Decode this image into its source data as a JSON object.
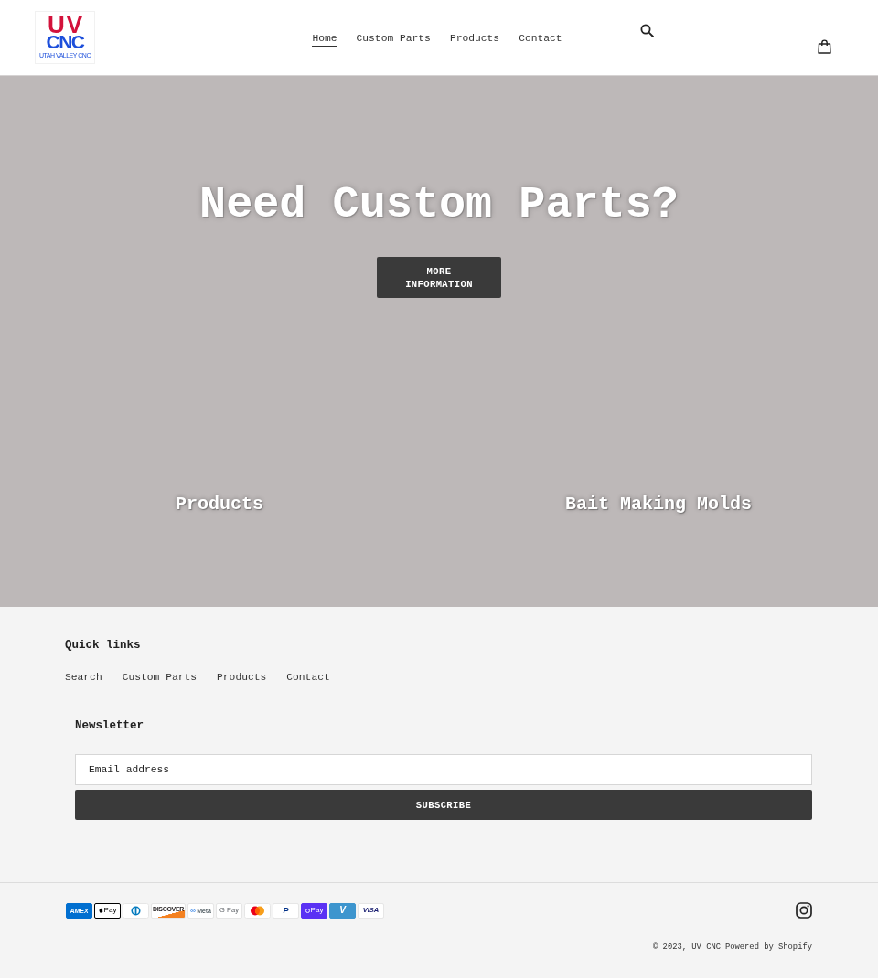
{
  "header": {
    "logo": {
      "top": "UV",
      "middle": "CNC",
      "tagline": "UTAH VALLEY CNC"
    },
    "nav": [
      {
        "label": "Home",
        "selected": true
      },
      {
        "label": "Custom Parts",
        "selected": false
      },
      {
        "label": "Products",
        "selected": false
      },
      {
        "label": "Contact",
        "selected": false
      }
    ]
  },
  "hero": {
    "heading": "Need Custom Parts?",
    "button": "MORE INFORMATION"
  },
  "collections": [
    {
      "title": "Products"
    },
    {
      "title": "Bait Making Molds"
    }
  ],
  "footer": {
    "quick_links": {
      "heading": "Quick links",
      "links": [
        "Search",
        "Custom Parts",
        "Products",
        "Contact"
      ]
    },
    "newsletter": {
      "heading": "Newsletter",
      "placeholder": "Email address",
      "button": "SUBSCRIBE"
    },
    "payment_icons": [
      {
        "kind": "amex",
        "text": "AMEX"
      },
      {
        "kind": "apple_pay",
        "text": "Pay"
      },
      {
        "kind": "diners"
      },
      {
        "kind": "discover",
        "text": "DISCOVER"
      },
      {
        "kind": "meta",
        "text": "Meta"
      },
      {
        "kind": "google_pay",
        "text": "G Pay"
      },
      {
        "kind": "mastercard"
      },
      {
        "kind": "paypal",
        "text": "P"
      },
      {
        "kind": "shop_pay",
        "text": "Pay"
      },
      {
        "kind": "venmo",
        "text": "V"
      },
      {
        "kind": "visa",
        "text": "VISA"
      }
    ],
    "copyright": "© 2023, UV CNC",
    "powered_by": "Powered by Shopify"
  }
}
